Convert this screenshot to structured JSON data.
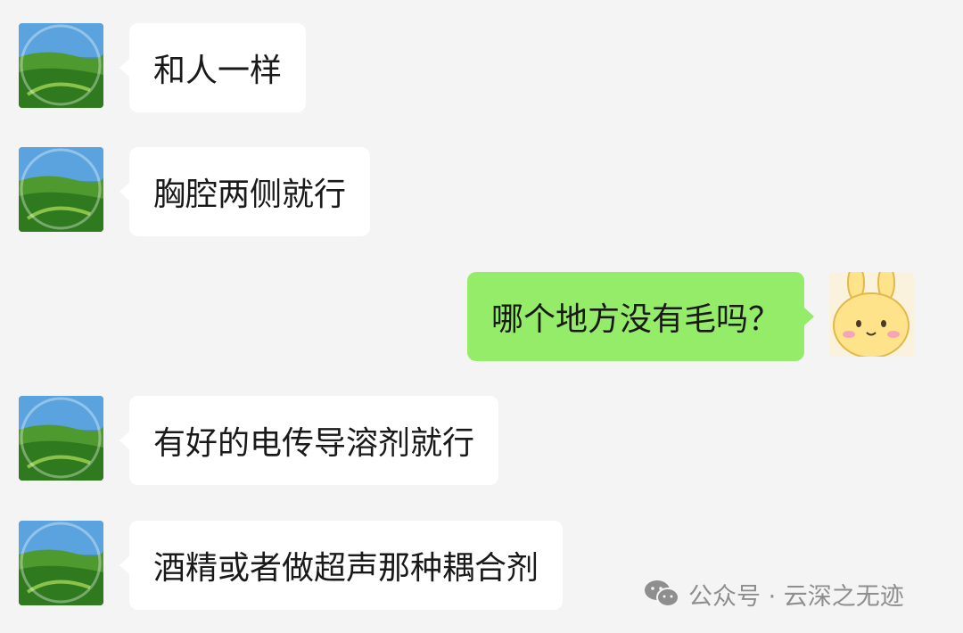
{
  "messages": [
    {
      "side": "in",
      "text": "和人一样"
    },
    {
      "side": "in",
      "text": "胸腔两侧就行"
    },
    {
      "side": "out",
      "text": "哪个地方没有毛吗？"
    },
    {
      "side": "in",
      "text": "有好的电传导溶剂就行"
    },
    {
      "side": "in",
      "text": "酒精或者做超声那种耦合剂"
    }
  ],
  "avatars": {
    "contact": "landscape-photo-avatar",
    "self": "cartoon-bunny-avatar"
  },
  "watermark": {
    "icon": "wechat-icon",
    "text": "公众号 · 云深之无迹"
  },
  "colors": {
    "background": "#f4f4f4",
    "incoming_bubble": "#ffffff",
    "outgoing_bubble": "#95ec69",
    "text": "#191919",
    "watermark": "#8e8e8e"
  }
}
